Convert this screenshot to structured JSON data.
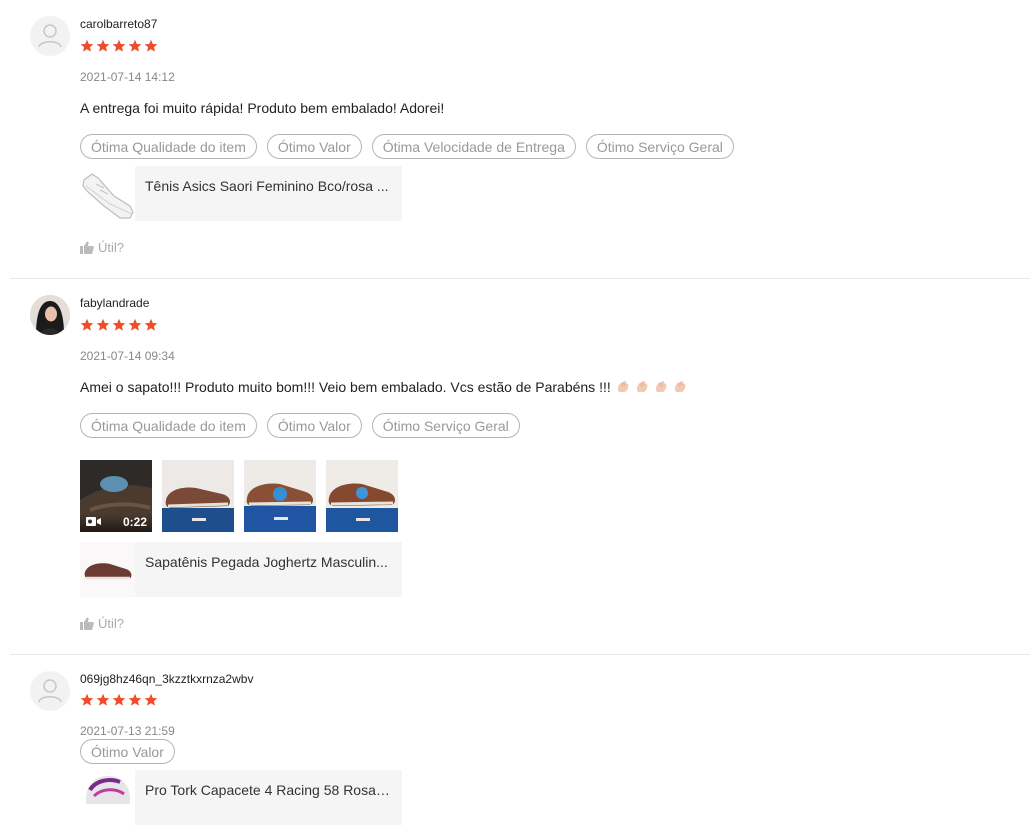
{
  "reviews": [
    {
      "username": "carolbarreto87",
      "rating": 5,
      "timestamp": "2021-07-14 14:12",
      "comment": "A entrega foi muito rápida! Produto bem embalado! Adorei!",
      "tags": [
        "Ótima Qualidade do item",
        "Ótimo Valor",
        "Ótima Velocidade de Entrega",
        "Ótimo Serviço Geral"
      ],
      "product_name": "Tênis Asics Saori Feminino Bco/rosa ...",
      "helpful_label": "Útil?"
    },
    {
      "username": "fabylandrade",
      "rating": 5,
      "timestamp": "2021-07-14 09:34",
      "comment": "Amei o sapato!!! Produto muito bom!!! Veio bem embalado. Vcs estão de Parabéns !!!",
      "tags": [
        "Ótima Qualidade do item",
        "Ótimo Valor",
        "Ótimo Serviço Geral"
      ],
      "video_duration": "0:22",
      "product_name": "Sapatênis Pegada Joghertz Masculin...",
      "helpful_label": "Útil?"
    },
    {
      "username": "069jg8hz46qn_3kzztkxrnza2wbv",
      "rating": 5,
      "timestamp": "2021-07-13 21:59",
      "tags": [
        "Ótimo Valor"
      ],
      "product_name": "Pro Tork Capacete 4 Racing 58 Rosa/..."
    }
  ],
  "colors": {
    "star": "#ee4d2d",
    "tag_border": "#b5b5b5",
    "muted_text": "#888888",
    "divider": "#e6e6e6",
    "product_bg": "#f5f5f5"
  },
  "icons": {
    "avatar_placeholder": "user-silhouette-icon",
    "star": "star-icon",
    "helpful": "thumbs-up-icon",
    "video": "video-camera-icon",
    "emoji": "clapping-hands-icon"
  }
}
